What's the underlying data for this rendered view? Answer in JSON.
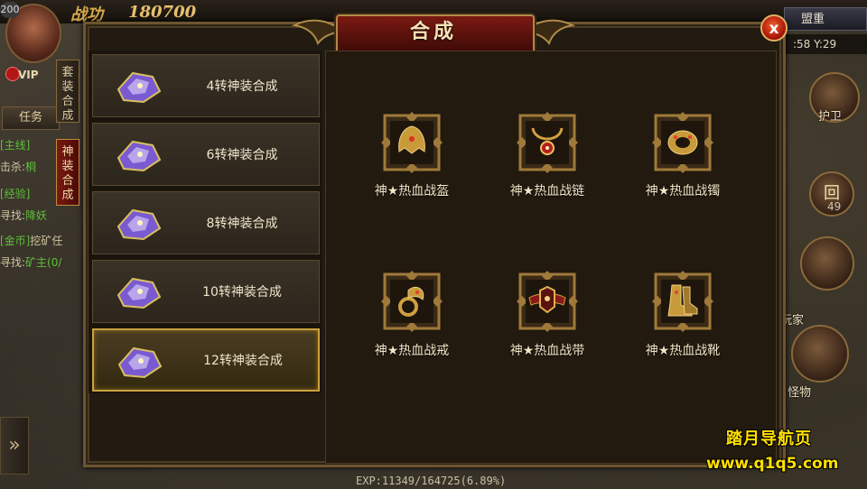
{
  "hud": {
    "level": "200",
    "power_label": "战功",
    "power_value": "180700",
    "vip": "VIP",
    "task_tab": "任务",
    "quests": [
      {
        "tag": "[主线]",
        "text": ""
      },
      {
        "tag": "击杀:",
        "text": "桐"
      },
      {
        "tag": "[经验]",
        "text": ""
      },
      {
        "tag": "寻找:",
        "text": "降妖"
      },
      {
        "tag": "[金币]",
        "text": "挖矿任"
      },
      {
        "tag": "寻找:",
        "text": "矿主(0/"
      }
    ],
    "alliance": "盟重",
    "coords": ":58 Y:29",
    "guard": "护卫",
    "players": "玩家",
    "monsters": "怪物",
    "count": "49",
    "exp": "EXP:11349/164725(6.89%)"
  },
  "panel": {
    "title": "合成",
    "close": "x",
    "side_tabs": [
      {
        "label": [
          "套",
          "装",
          "合",
          "成"
        ],
        "active": false
      },
      {
        "label": [
          "神",
          "装",
          "合",
          "成"
        ],
        "active": true
      }
    ],
    "list": [
      {
        "label": "4转神装合成",
        "selected": false
      },
      {
        "label": "6转神装合成",
        "selected": false
      },
      {
        "label": "8转神装合成",
        "selected": false
      },
      {
        "label": "10转神装合成",
        "selected": false
      },
      {
        "label": "12转神装合成",
        "selected": true
      }
    ],
    "items": [
      {
        "name": "神★热血战盔",
        "icon": "helmet-icon"
      },
      {
        "name": "神★热血战链",
        "icon": "necklace-icon"
      },
      {
        "name": "神★热血战镯",
        "icon": "bracelet-icon"
      },
      {
        "name": "神★热血战戒",
        "icon": "ring-icon"
      },
      {
        "name": "神★热血战带",
        "icon": "belt-icon"
      },
      {
        "name": "神★热血战靴",
        "icon": "boots-icon"
      }
    ]
  },
  "watermark": {
    "line1": "踏月导航页",
    "line2": "www.q1q5.com"
  },
  "colors": {
    "gold": "#c9a13c",
    "title_red": "#7a1a12",
    "watermark": "#ffe000"
  }
}
